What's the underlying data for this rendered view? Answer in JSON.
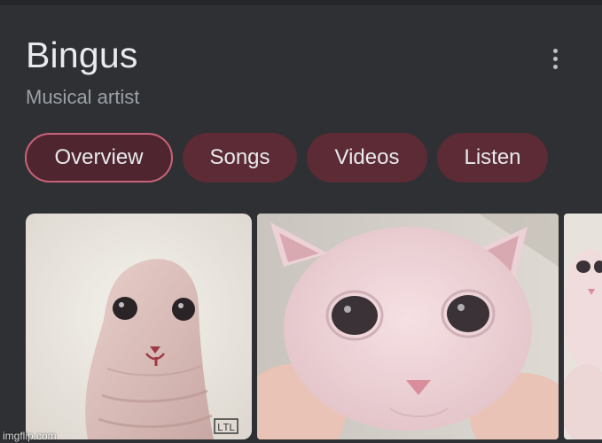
{
  "entity": {
    "title": "Bingus",
    "subtitle": "Musical artist"
  },
  "menu": {
    "icon": "more-vert-icon"
  },
  "tabs": [
    {
      "label": "Overview",
      "selected": true
    },
    {
      "label": "Songs",
      "selected": false
    },
    {
      "label": "Videos",
      "selected": false
    },
    {
      "label": "Listen",
      "selected": false
    }
  ],
  "images": [
    {
      "name": "bingus-painting",
      "signature": "LTL"
    },
    {
      "name": "bingus-photo"
    },
    {
      "name": "bingus-photo-partial"
    }
  ],
  "watermark": "imgflip.com",
  "colors": {
    "background": "#2f3033",
    "chip": "#5c2b35",
    "chip_active_border": "#c9627a",
    "title": "#e8eaed",
    "subtitle": "#9aa0a6"
  }
}
